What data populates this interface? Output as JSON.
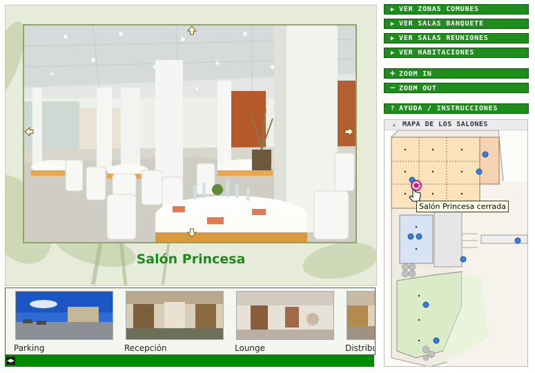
{
  "nav_buttons": [
    {
      "label": "VER ZONAS COMUNES",
      "icon": "play-triangle"
    },
    {
      "label": "VER SALAS BANQUETE",
      "icon": "play-triangle"
    },
    {
      "label": "VER SALAS REUNIONES",
      "icon": "play-triangle"
    },
    {
      "label": "VER HABITACIONES",
      "icon": "play-triangle"
    }
  ],
  "zoom": {
    "in_label": "ZOOM IN",
    "out_label": "ZOOM OUT"
  },
  "help": {
    "label": "AYUDA / INSTRUCCIONES"
  },
  "map": {
    "title": "MAPA DE LOS SALONES"
  },
  "tooltip": "Salón Princesa cerrada",
  "viewer": {
    "room_title": "Salón Princesa"
  },
  "thumbnails": [
    {
      "label": "Parking"
    },
    {
      "label": "Recepción"
    },
    {
      "label": "Lounge"
    },
    {
      "label": "Distribu"
    }
  ],
  "colors": {
    "accent_green": "#1f8d1c",
    "title_green": "#1e8a1e",
    "hotspot_blue": "#3a7fd6",
    "active_marker": "#c01899"
  }
}
